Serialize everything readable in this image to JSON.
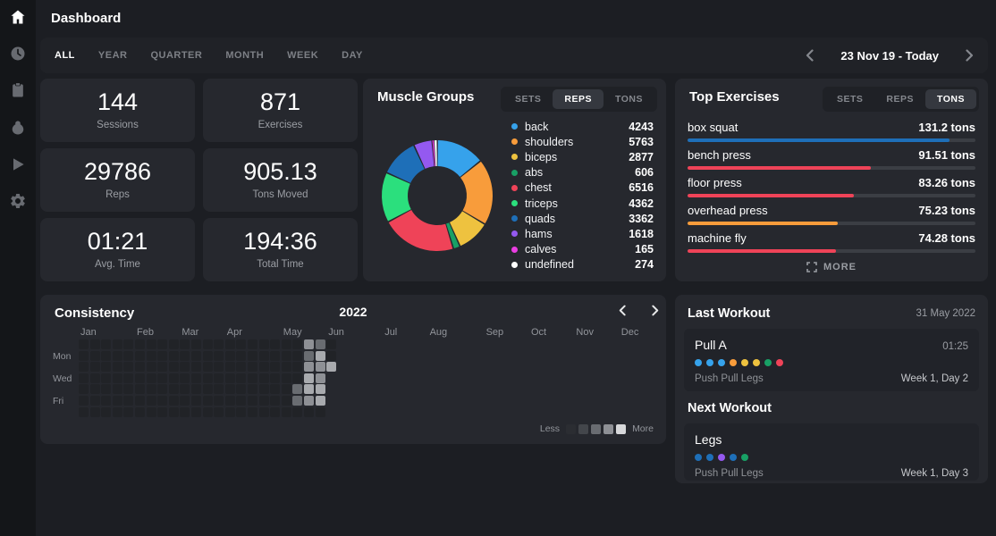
{
  "app": {
    "title": "Dashboard"
  },
  "sidebar": {
    "items": [
      {
        "icon": "home",
        "active": true
      },
      {
        "icon": "history",
        "active": false
      },
      {
        "icon": "clipboard",
        "active": false
      },
      {
        "icon": "weight",
        "active": false
      },
      {
        "icon": "play",
        "active": false
      },
      {
        "icon": "settings",
        "active": false
      }
    ]
  },
  "filters": {
    "options": [
      "ALL",
      "YEAR",
      "QUARTER",
      "MONTH",
      "WEEK",
      "DAY"
    ],
    "active": "ALL",
    "date_range": "23 Nov 19 - Today"
  },
  "stats": [
    {
      "value": "144",
      "label": "Sessions"
    },
    {
      "value": "871",
      "label": "Exercises"
    },
    {
      "value": "29786",
      "label": "Reps"
    },
    {
      "value": "905.13",
      "label": "Tons Moved"
    },
    {
      "value": "01:21",
      "label": "Avg. Time"
    },
    {
      "value": "194:36",
      "label": "Total Time"
    }
  ],
  "muscle_groups": {
    "title": "Muscle Groups",
    "tabs": [
      "SETS",
      "REPS",
      "TONS"
    ],
    "active_tab": "REPS"
  },
  "top_exercises": {
    "title": "Top Exercises",
    "tabs": [
      "SETS",
      "REPS",
      "TONS"
    ],
    "active_tab": "TONS",
    "more_label": "MORE"
  },
  "consistency": {
    "title": "Consistency",
    "year": "2022",
    "months": [
      "Jan",
      "Feb",
      "Mar",
      "Apr",
      "May",
      "Jun",
      "Jul",
      "Aug",
      "Sep",
      "Oct",
      "Nov",
      "Dec"
    ],
    "day_labels": [
      "Mon",
      "Wed",
      "Fri"
    ],
    "legend": {
      "less": "Less",
      "more": "More"
    }
  },
  "last_workout": {
    "title": "Last Workout",
    "date": "31 May 2022",
    "card": {
      "name": "Pull A",
      "duration": "01:25",
      "dot_colors": [
        "#36a2eb",
        "#36a2eb",
        "#36a2eb",
        "#f89c3b",
        "#eec23f",
        "#eec23f",
        "#18a065",
        "#ef4358"
      ],
      "program": "Push Pull Legs",
      "position": "Week 1, Day 2"
    }
  },
  "next_workout": {
    "title": "Next Workout",
    "card": {
      "name": "Legs",
      "dot_colors": [
        "#1e6fb8",
        "#1e6fb8",
        "#9459f0",
        "#1e6fb8",
        "#18a065"
      ],
      "program": "Push Pull Legs",
      "position": "Week 1, Day 3"
    }
  },
  "chart_data": [
    {
      "type": "pie",
      "title": "Muscle Groups",
      "unit": "reps",
      "legend_position": "right",
      "labels": [
        "back",
        "shoulders",
        "biceps",
        "abs",
        "chest",
        "triceps",
        "quads",
        "hams",
        "calves",
        "undefined"
      ],
      "values": [
        4243,
        5763,
        2877,
        606,
        6516,
        4362,
        3362,
        1618,
        165,
        274
      ],
      "colors": [
        "#36a2eb",
        "#f89c3b",
        "#eec23f",
        "#18a065",
        "#ef4358",
        "#2bdf7d",
        "#1e6fb8",
        "#9459f0",
        "#ea3ee2",
        "#ffffff"
      ]
    },
    {
      "type": "bar",
      "title": "Top Exercises",
      "unit": "tons",
      "categories": [
        "box squat",
        "bench press",
        "floor press",
        "overhead press",
        "machine fly"
      ],
      "values": [
        131.2,
        91.51,
        83.26,
        75.23,
        74.28
      ],
      "value_labels": [
        "131.2 tons",
        "91.51 tons",
        "83.26 tons",
        "75.23 tons",
        "74.28 tons"
      ],
      "colors": [
        "#1e6fb8",
        "#ef4358",
        "#ef4358",
        "#f89c3b",
        "#ef4358"
      ],
      "xlim": [
        0,
        144
      ]
    },
    {
      "type": "heatmap",
      "title": "Consistency",
      "year": "2022",
      "rows": 7,
      "cols": 23,
      "month_start_weeks": [
        0,
        5,
        9,
        13,
        18,
        22,
        27,
        31,
        36,
        40,
        44,
        48
      ],
      "day_rows": [
        1,
        3,
        5
      ],
      "level_colors": [
        "#2b2d32",
        "#43464b",
        "#696c71",
        "#8e9095",
        "#d7d8da"
      ],
      "cell_level_colors": [
        "#43464b",
        "#696c71",
        "#8e9095",
        "#a8aaae"
      ],
      "filled": [
        {
          "row": 0,
          "col": 20,
          "level": 3
        },
        {
          "row": 0,
          "col": 21,
          "level": 2
        },
        {
          "row": 1,
          "col": 20,
          "level": 2
        },
        {
          "row": 1,
          "col": 21,
          "level": 4
        },
        {
          "row": 2,
          "col": 20,
          "level": 3
        },
        {
          "row": 2,
          "col": 21,
          "level": 3
        },
        {
          "row": 2,
          "col": 22,
          "level": 4
        },
        {
          "row": 3,
          "col": 20,
          "level": 4
        },
        {
          "row": 3,
          "col": 21,
          "level": 3
        },
        {
          "row": 4,
          "col": 19,
          "level": 2
        },
        {
          "row": 4,
          "col": 20,
          "level": 4
        },
        {
          "row": 4,
          "col": 21,
          "level": 4
        },
        {
          "row": 5,
          "col": 19,
          "level": 2
        },
        {
          "row": 5,
          "col": 20,
          "level": 3
        },
        {
          "row": 5,
          "col": 21,
          "level": 4
        }
      ]
    }
  ]
}
